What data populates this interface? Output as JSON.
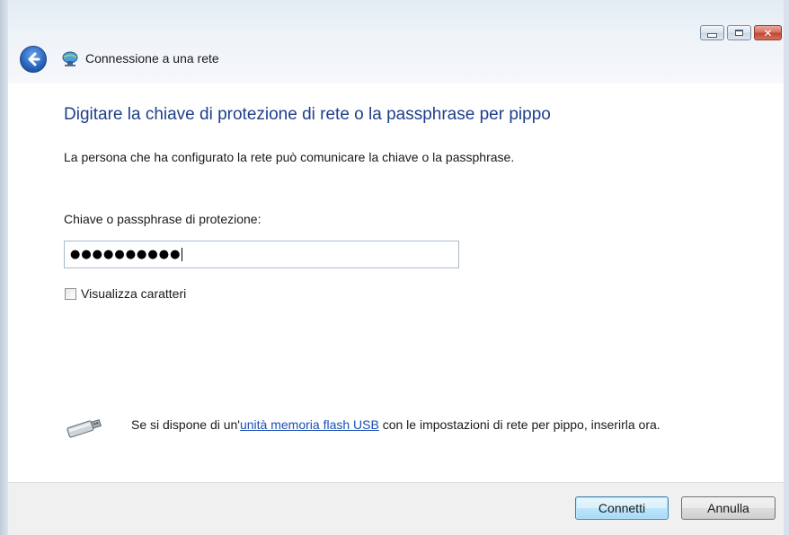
{
  "window": {
    "title": "Connessione a una rete",
    "caption_buttons": {
      "minimize_icon": "minimize-icon",
      "maximize_icon": "maximize-icon",
      "close_icon": "close-icon",
      "close_glyph": "✕"
    }
  },
  "content": {
    "heading": "Digitare la chiave di protezione di rete o la passphrase per pippo",
    "description": "La persona che ha configurato la rete può comunicare la chiave o la passphrase.",
    "key_label": "Chiave o passphrase di protezione:",
    "key_value_masked": "●●●●●●●●●●",
    "show_characters": {
      "label": "Visualizza caratteri",
      "checked": false
    },
    "usb": {
      "text_before": "Se si dispone di un'",
      "link": "unità memoria flash USB",
      "text_after": " con le impostazioni di rete per pippo, inserirla ora.",
      "icon": "usb-drive-icon"
    }
  },
  "footer": {
    "connect_label": "Connetti",
    "cancel_label": "Annulla"
  },
  "colors": {
    "heading": "#1e3f8a",
    "link": "#1a4fb5",
    "close_button": "#c0422e"
  }
}
